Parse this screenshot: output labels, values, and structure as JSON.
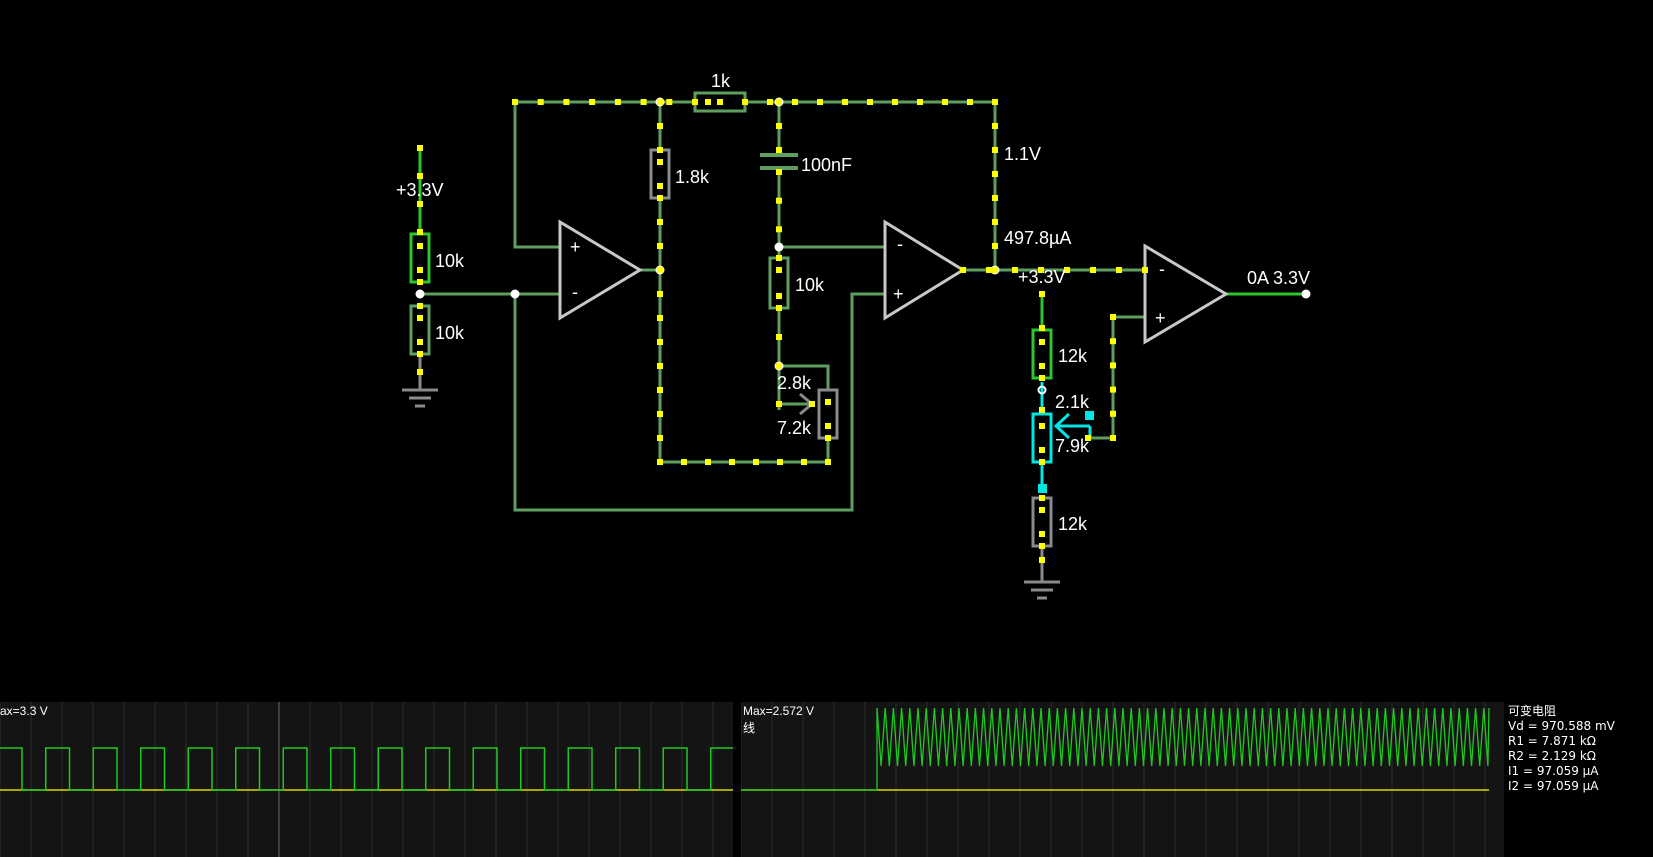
{
  "circuit": {
    "labels": {
      "vsrc1": "+3.3V",
      "r_top_left": "10k",
      "r_bottom_left": "10k",
      "r_1k": "1k",
      "r_1_8k": "1.8k",
      "c_100nf": "100nF",
      "r_10k_mid": "10k",
      "pot1_upper": "2.8k",
      "pot1_lower": "7.2k",
      "voltage_1_1v": "1.1V",
      "current": "497.8µA",
      "vsrc2": "+3.3V",
      "r_12k_top": "12k",
      "pot2_upper": "2.1k",
      "pot2_lower": "7.9k",
      "r_12k_bottom": "12k",
      "output": "0A 3.3V"
    },
    "opamp_signs": {
      "plus": "+",
      "minus": "-"
    },
    "colors": {
      "wire": "#5e9e5e",
      "wire_gray": "#8a8a8a",
      "bright_green": "#2dc42d",
      "highlight": "#00e5e5",
      "current_dots": "#ffff00",
      "opamp": "#c8c8c8"
    }
  },
  "scopes": [
    {
      "max_label": "ax=3.3 V",
      "sub_label": "",
      "trace": "square",
      "trace_color": "#1fc91f",
      "baseline_color": "#d8d800"
    },
    {
      "max_label": "Max=2.572 V",
      "sub_label": "线",
      "trace": "triangle",
      "trace_color": "#1fc91f",
      "baseline_color": "#d8d800"
    }
  ],
  "info_panel": {
    "title": "可变电阻",
    "lines": [
      "Vd = 970.588 mV",
      "R1 = 7.871 kΩ",
      "R2 = 2.129 kΩ",
      "I1 = 97.059 µA",
      "I2 = 97.059 µA"
    ]
  }
}
